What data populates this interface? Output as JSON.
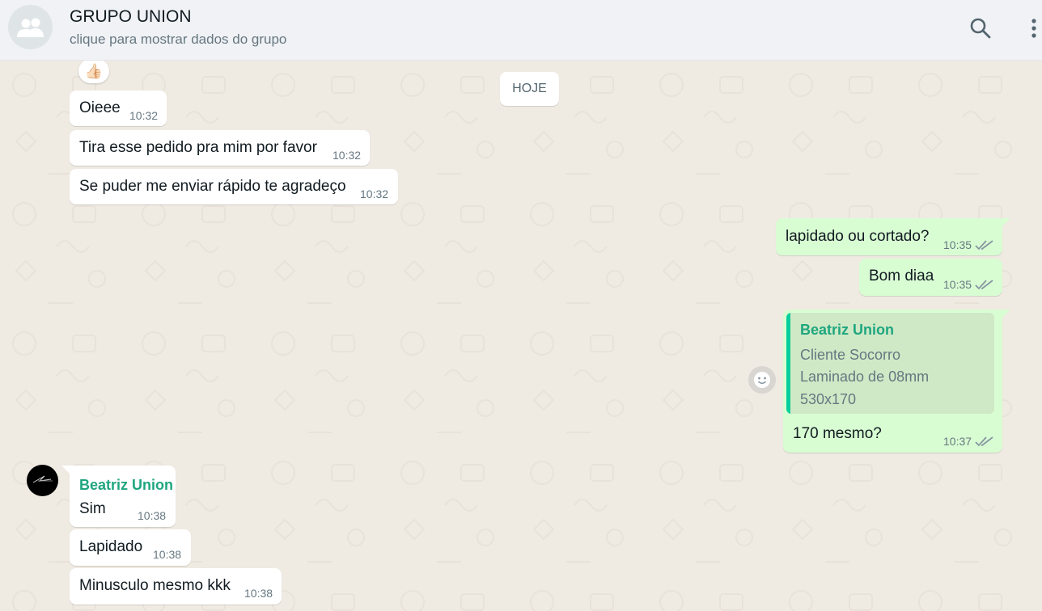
{
  "header": {
    "title": "GRUPO UNION",
    "subtitle": "clique para mostrar dados do grupo",
    "avatar_icon": "group-icon",
    "search_icon": "search-icon",
    "menu_icon": "more-vertical-icon"
  },
  "date_divider": "HOJE",
  "reaction": "👍🏻",
  "messages_top": [
    {
      "text": "Oieee",
      "time": "10:32"
    },
    {
      "text": "Tira esse pedido pra mim por favor",
      "time": "10:32"
    },
    {
      "text": "Se puder me enviar rápido te agradeço",
      "time": "10:32"
    }
  ],
  "messages_out": [
    {
      "text": "lapidado ou cortado?",
      "time": "10:35"
    },
    {
      "text": "Bom diaa",
      "time": "10:35"
    }
  ],
  "reply_message": {
    "quoted_sender": "Beatriz Union",
    "quoted_lines": [
      "Cliente Socorro",
      "Laminado de 08mm",
      "530x170"
    ],
    "text": "170 mesmo?",
    "time": "10:37"
  },
  "messages_bottom": {
    "sender": "Beatriz Union",
    "items": [
      {
        "text": "Sim",
        "time": "10:38"
      },
      {
        "text": "Lapidado",
        "time": "10:38"
      },
      {
        "text": "Minusculo mesmo kkk",
        "time": "10:38"
      }
    ]
  },
  "colors": {
    "chat_bg": "#efeae2",
    "incoming": "#ffffff",
    "outgoing": "#d9fdd3",
    "sender_name": "#1fa67f",
    "quote_bar": "#06cf9c"
  }
}
